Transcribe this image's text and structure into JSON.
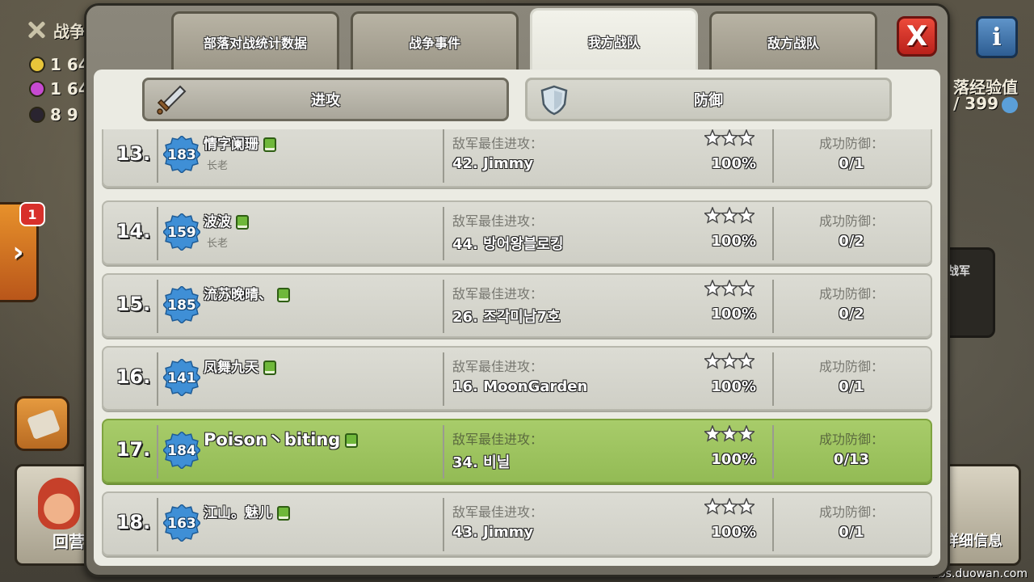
{
  "hud": {
    "war_label": "战争",
    "resources": [
      {
        "icon": "gold-coin-icon",
        "value": "1 64",
        "color": "#e8c53a"
      },
      {
        "icon": "elixir-drop-icon",
        "value": "1 64",
        "color": "#c64ad1"
      },
      {
        "icon": "dark-elixir-icon",
        "value": "8 9",
        "color": "#2a2430"
      }
    ],
    "notification_count": "1",
    "home_label": "回营",
    "xp_label": "落经验值",
    "xp_value": "/ 399",
    "enemy_side_label": "战军",
    "details_label": "详细信息",
    "info_icon_glyph": "i",
    "side_arrow_glyph": "›"
  },
  "tabs": [
    {
      "label": "部落对战统计数据",
      "active": false
    },
    {
      "label": "战争事件",
      "active": false
    },
    {
      "label": "我方战队",
      "active": true
    },
    {
      "label": "敌方战队",
      "active": false
    }
  ],
  "close_glyph": "X",
  "subtabs": [
    {
      "label": "进攻",
      "icon": "sword-icon",
      "active": false
    },
    {
      "label": "防御",
      "icon": "shield-icon",
      "active": true
    }
  ],
  "labels": {
    "enemy_best_attack": "敌军最佳进攻：",
    "successful_defense": "成功防御："
  },
  "members": [
    {
      "rank": "13.",
      "level": "183",
      "name": "情字阑珊",
      "role": "长老",
      "best_attack": "42. Jimmy",
      "stars": 3,
      "percent": "100%",
      "defenses": "0/1",
      "highlight": false
    },
    {
      "rank": "14.",
      "level": "159",
      "name": "波波",
      "role": "长老",
      "best_attack": "44. 방어왕블로킹",
      "stars": 3,
      "percent": "100%",
      "defenses": "0/2",
      "highlight": false
    },
    {
      "rank": "15.",
      "level": "185",
      "name": "流苏晚晴、",
      "role": "",
      "best_attack": "26. 조각미남7호",
      "stars": 3,
      "percent": "100%",
      "defenses": "0/2",
      "highlight": false
    },
    {
      "rank": "16.",
      "level": "141",
      "name": "凤舞九天",
      "role": "",
      "best_attack": "16. MoonGarden",
      "stars": 3,
      "percent": "100%",
      "defenses": "0/1",
      "highlight": false
    },
    {
      "rank": "17.",
      "level": "184",
      "name": "Poison丶biting",
      "role": "",
      "best_attack": "34. 비닐",
      "stars": 3,
      "percent": "100%",
      "defenses": "0/13",
      "highlight": true
    },
    {
      "rank": "18.",
      "level": "163",
      "name": "江山。魅儿",
      "role": "",
      "best_attack": "43. Jimmy",
      "stars": 3,
      "percent": "100%",
      "defenses": "0/1",
      "highlight": false
    }
  ],
  "watermark": "bbs.duowan.com",
  "colors": {
    "highlight_row": "#a8cc6a",
    "level_badge": "#3f8fd6",
    "close_button": "#d9342a",
    "panel_inner": "#ebebe3"
  }
}
